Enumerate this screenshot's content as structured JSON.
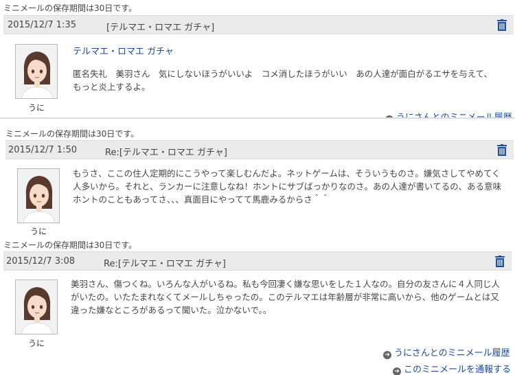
{
  "colors": {
    "header_bg": "#eaeaea",
    "link": "#1a4a9a",
    "trash": "#1f4f9c"
  },
  "messages": [
    {
      "notice": "ミニメールの保存期間は30日です。",
      "date": "2015/12/7 1:35",
      "subject": "[テルマエ・ロマエ ガチャ]",
      "title_link": "テルマエ・ロマエ ガチャ",
      "body": "匿名失礼　美羽さん　気にしないほうがいいよ　コメ消したほうがいい　あの人達が面白がるエサを与えて、もっと炎上するよ。",
      "user": "うに",
      "footer_partial": "うにさんとのミニメール履歴",
      "trash_icon": "trash-icon"
    },
    {
      "notice": "ミニメールの保存期間は30日です。",
      "date": "2015/12/7 1:50",
      "subject": "Re:[テルマエ・ロマエ ガチャ]",
      "body": "もうさ、ここの住人定期的にこうやって楽しむんだよ。ネットゲームは、そういうものさ。嫌気さしてやめてく人多いから。それと、ランカーに注意しなね！ホントにサブばっかりなのさ。あの人達が書いてるの、ある意味ホントのこともあってさ、、、真面目にやってて馬鹿みるからさ＾＾",
      "user": "うに",
      "trash_icon": "trash-icon"
    },
    {
      "notice": "ミニメールの保存期間は30日です。",
      "date": "2015/12/7 3:08",
      "subject": "Re:[テルマエ・ロマエ ガチャ]",
      "body": "美羽さん、傷つくね。いろんな人がいるね。私も今回凄く嫌な思いをした１人なの。自分の友さんに４人同じ人がいたの。いたたまれなくてメールしちゃったの。このテルマエは年齢層が非常に高いから、他のゲームとは又違った嫌なところがあるって聞いた。泣かないで。。",
      "user": "うに",
      "trash_icon": "trash-icon"
    }
  ],
  "footer_links": {
    "history": "うにさんとのミニメール履歴",
    "report": "このミニメールを通報する"
  }
}
